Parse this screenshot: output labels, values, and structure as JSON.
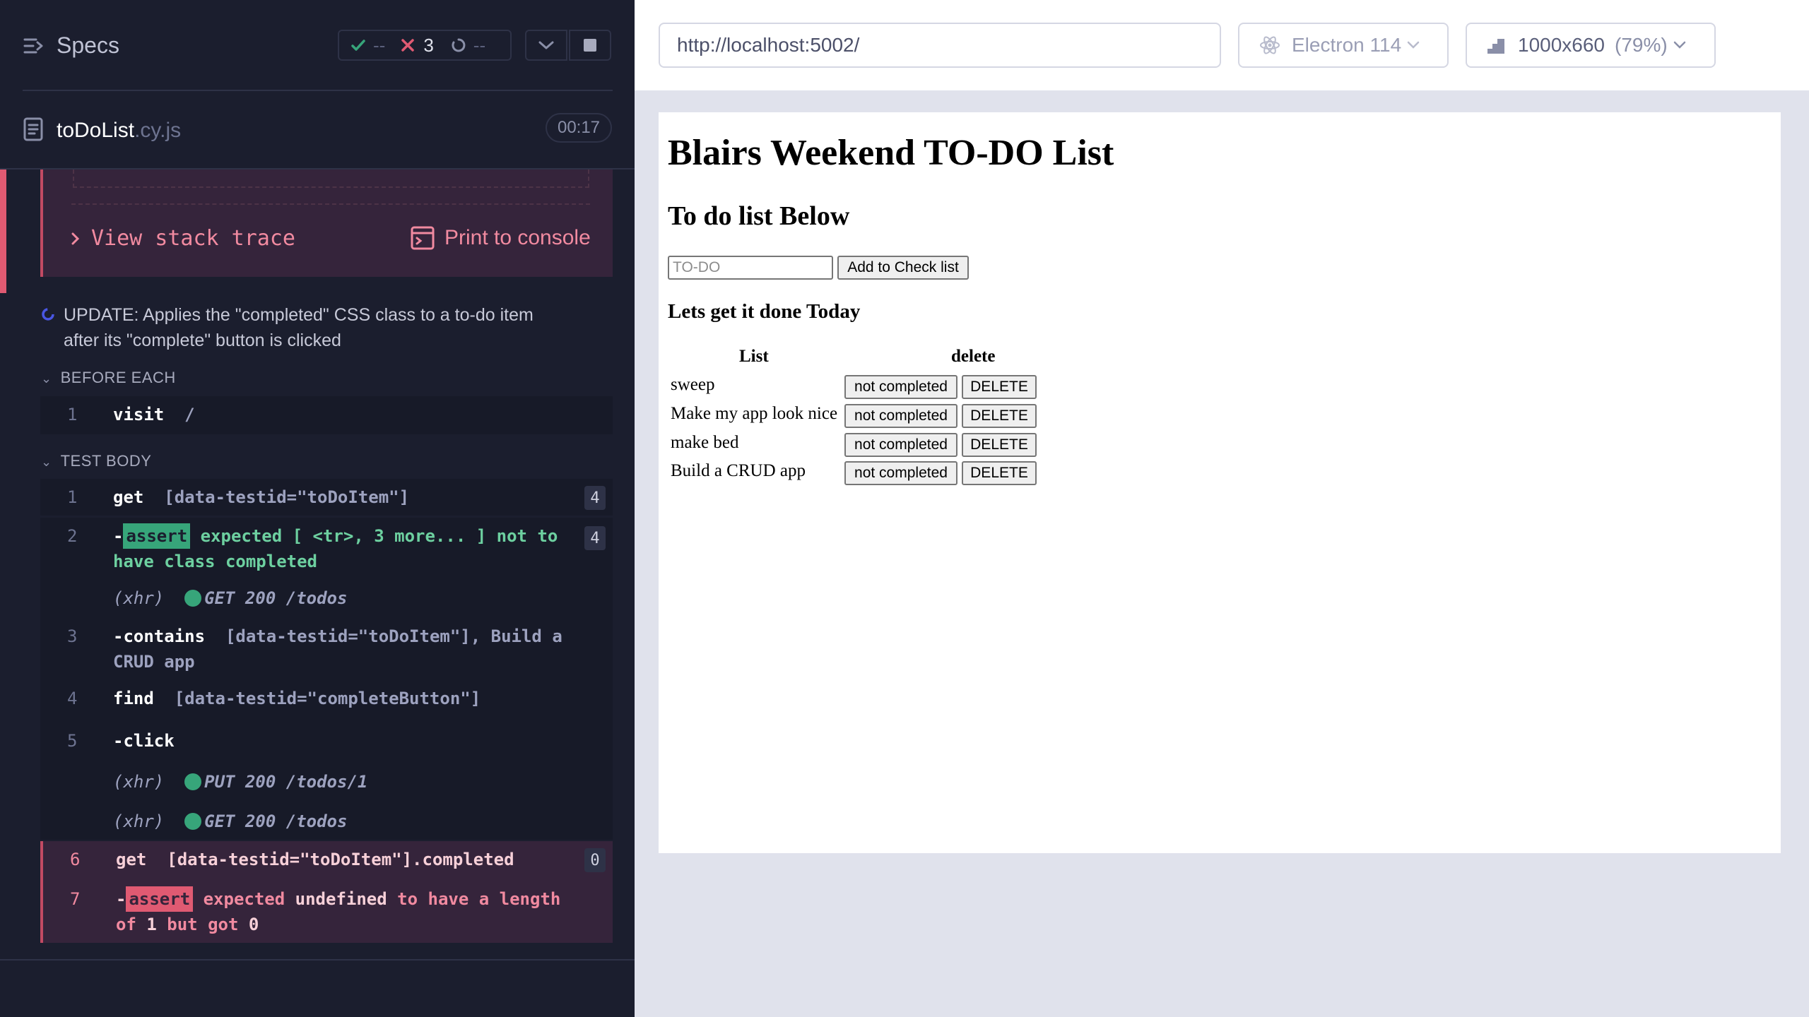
{
  "reporter": {
    "header": {
      "title": "Specs",
      "stats": {
        "passed": "--",
        "failed": "3",
        "pending": "--"
      }
    },
    "spec": {
      "name": "toDoList",
      "ext": ".cy.js",
      "duration": "00:17"
    },
    "error": {
      "stack_trace_label": "View stack trace",
      "print_label": "Print to console"
    },
    "test": {
      "title_line1": "UPDATE: Applies the \"completed\" CSS class to a to-do item",
      "title_line2": "after its \"complete\" button is clicked"
    },
    "before_each": {
      "label": "BEFORE EACH",
      "commands": [
        {
          "num": "1",
          "name": "visit",
          "arg": "/"
        }
      ]
    },
    "test_body": {
      "label": "TEST BODY",
      "cmd1": {
        "num": "1",
        "name": "get",
        "arg": "[data-testid=\"toDoItem\"]",
        "count": "4"
      },
      "cmd2": {
        "num": "2",
        "prefix": "-",
        "badge": "assert",
        "w1": "expected",
        "w2": "[ <tr>, 3 more... ]",
        "w3": "not to",
        "w4": "have class",
        "w5": "completed",
        "count": "4"
      },
      "xhr1": {
        "label": "(xhr)",
        "method": "GET 200 /todos"
      },
      "cmd3": {
        "num": "3",
        "prefix": "-",
        "name": "contains",
        "arg1": "[data-testid=\"toDoItem\"], Build a",
        "arg2": "CRUD app"
      },
      "cmd4": {
        "num": "4",
        "name": "find",
        "arg": "[data-testid=\"completeButton\"]"
      },
      "cmd5": {
        "num": "5",
        "prefix": "-",
        "name": "click"
      },
      "xhr2": {
        "label": "(xhr)",
        "method": "PUT 200 /todos/1"
      },
      "xhr3": {
        "label": "(xhr)",
        "method": "GET 200 /todos"
      },
      "cmd6": {
        "num": "6",
        "name": "get",
        "arg": "[data-testid=\"toDoItem\"].completed",
        "count": "0"
      },
      "cmd7": {
        "num": "7",
        "prefix": "-",
        "badge": "assert",
        "w1": "expected",
        "w2": "undefined",
        "w3": "to have a length",
        "w4": "of",
        "w5": "1",
        "w6": "but got",
        "w7": "0"
      }
    }
  },
  "aut": {
    "url": "http://localhost:5002/",
    "browser": "Electron 114",
    "viewport": "1000x660",
    "scale": "(79%)",
    "page": {
      "title": "Blairs Weekend TO-DO List",
      "subtitle": "To do list Below",
      "input_placeholder": "TO-DO",
      "add_button": "Add to Check list",
      "section": "Lets get it done Today",
      "col_list": "List",
      "col_delete": "delete",
      "rows": [
        {
          "item": "sweep",
          "status": "not completed",
          "delete": "DELETE"
        },
        {
          "item": "Make my app look nice",
          "status": "not completed",
          "delete": "DELETE"
        },
        {
          "item": "make bed",
          "status": "not completed",
          "delete": "DELETE"
        },
        {
          "item": "Build a CRUD app",
          "status": "not completed",
          "delete": "DELETE"
        }
      ]
    }
  },
  "colors": {
    "reporter_bg": "#1b1e2e",
    "fail": "#e05a72",
    "pass": "#37a57a",
    "aut_bg": "#e0e2ec"
  }
}
